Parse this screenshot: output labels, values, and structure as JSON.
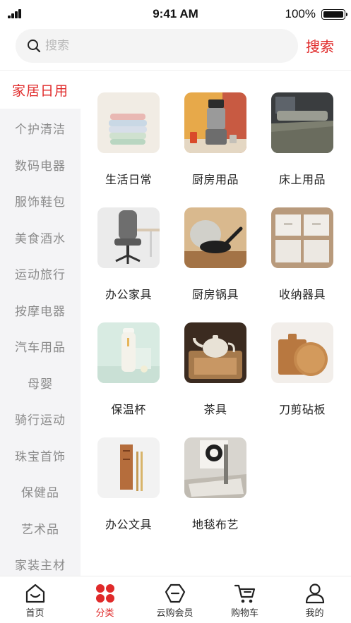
{
  "status_bar": {
    "time": "9:41 AM",
    "battery": "100%"
  },
  "search": {
    "placeholder": "搜索",
    "button_label": "搜索"
  },
  "sidebar": {
    "items": [
      {
        "label": "家居日用",
        "active": true
      },
      {
        "label": "个护清洁"
      },
      {
        "label": "数码电器"
      },
      {
        "label": "服饰鞋包"
      },
      {
        "label": "美食酒水"
      },
      {
        "label": "运动旅行"
      },
      {
        "label": "按摩电器"
      },
      {
        "label": "汽车用品"
      },
      {
        "label": "母婴"
      },
      {
        "label": "骑行运动"
      },
      {
        "label": "珠宝首饰"
      },
      {
        "label": "保健品"
      },
      {
        "label": "艺术品"
      },
      {
        "label": "家装主材"
      }
    ]
  },
  "categories": [
    {
      "label": "生活日常",
      "image": "towels-image"
    },
    {
      "label": "厨房用品",
      "image": "juicer-image"
    },
    {
      "label": "床上用品",
      "image": "bed-image"
    },
    {
      "label": "办公家具",
      "image": "office-chair-image"
    },
    {
      "label": "厨房锅具",
      "image": "frying-pan-image"
    },
    {
      "label": "收纳器具",
      "image": "storage-boxes-image"
    },
    {
      "label": "保温杯",
      "image": "thermos-image"
    },
    {
      "label": "茶具",
      "image": "teapot-image"
    },
    {
      "label": "刀剪砧板",
      "image": "cutting-board-image"
    },
    {
      "label": "办公文具",
      "image": "stationery-image"
    },
    {
      "label": "地毯布艺",
      "image": "rug-image"
    }
  ],
  "tabbar": {
    "items": [
      {
        "label": "首页",
        "icon": "home-icon"
      },
      {
        "label": "分类",
        "icon": "category-icon",
        "active": true
      },
      {
        "label": "云购会员",
        "icon": "member-icon"
      },
      {
        "label": "购物车",
        "icon": "cart-icon"
      },
      {
        "label": "我的",
        "icon": "profile-icon"
      }
    ]
  },
  "colors": {
    "accent": "#e02a2a",
    "sidebar_bg": "#f4f4f6",
    "muted_text": "#8a8a8a"
  }
}
